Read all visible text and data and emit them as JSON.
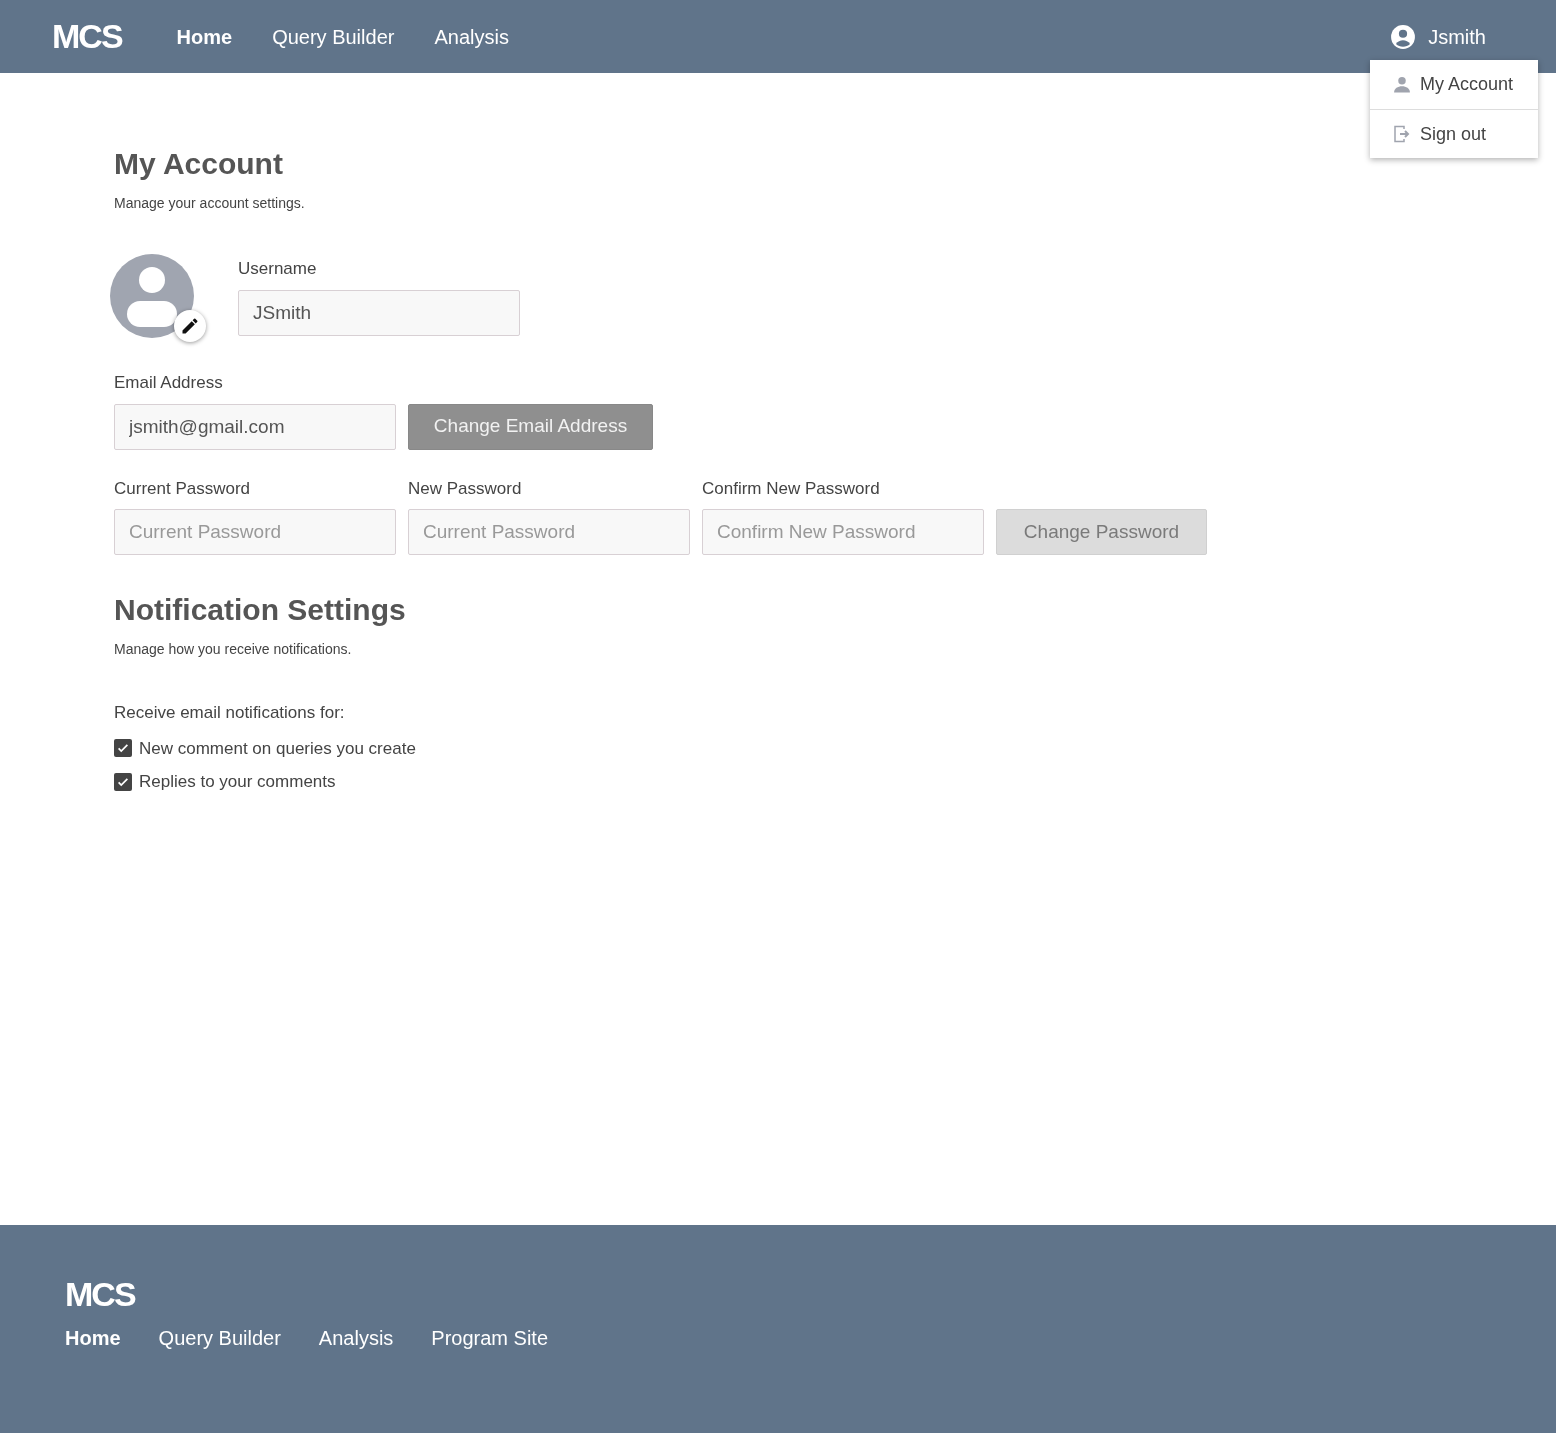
{
  "header": {
    "logo": "MCS",
    "nav": [
      {
        "label": "Home",
        "selected": true
      },
      {
        "label": "Query Builder",
        "selected": false
      },
      {
        "label": "Analysis",
        "selected": false
      }
    ],
    "user": "Jsmith"
  },
  "user_menu": {
    "items": [
      {
        "kind": "account",
        "label": "My Account"
      },
      {
        "kind": "signout",
        "label": "Sign out"
      }
    ]
  },
  "account": {
    "title": "My Account",
    "subtitle": "Manage your account settings.",
    "username": {
      "label": "Username",
      "value": "JSmith"
    },
    "email": {
      "label": "Email Address",
      "value": "jsmith@gmail.com",
      "button": {
        "label": "Change Email Address",
        "disabled": false
      }
    },
    "passwords": [
      {
        "label": "Current Password",
        "placeholder": "Current Password"
      },
      {
        "label": "New Password",
        "placeholder": "Current Password"
      },
      {
        "label": "Confirm New Password",
        "placeholder": "Confirm New Password"
      }
    ],
    "password_button": {
      "label": "Change Password",
      "disabled": true
    }
  },
  "notifications": {
    "title": "Notification Settings",
    "subtitle": "Manage how you receive notifications.",
    "prompt": "Receive email notifications for:",
    "options": [
      {
        "label": "New comment on queries you create",
        "checked": true
      },
      {
        "label": "Replies to your comments",
        "checked": true
      }
    ]
  },
  "footer": {
    "logo": "MCS",
    "links": [
      {
        "label": "Home",
        "selected": true
      },
      {
        "label": "Query Builder",
        "selected": false
      },
      {
        "label": "Analysis",
        "selected": false
      },
      {
        "label": "Program Site",
        "selected": false
      }
    ]
  }
}
